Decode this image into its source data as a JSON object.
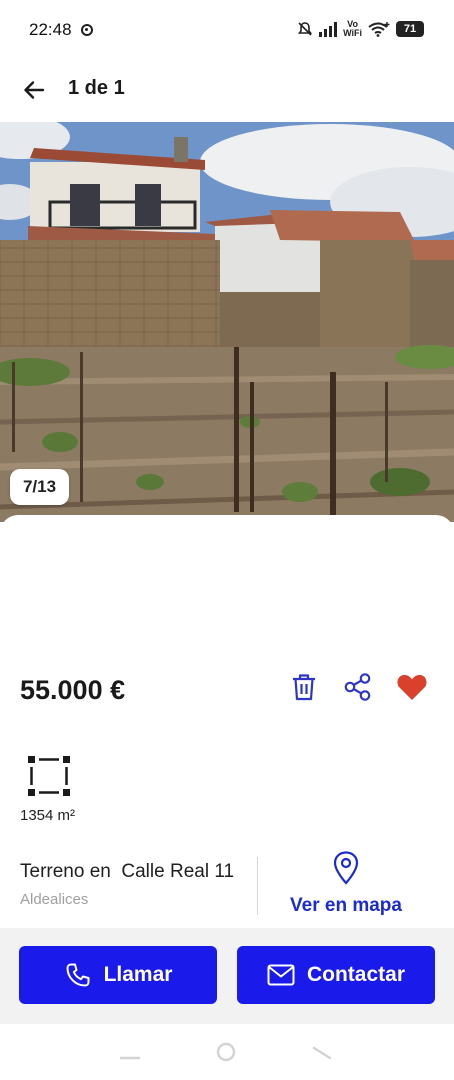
{
  "status_bar": {
    "time": "22:48",
    "vowifi_top": "Vo",
    "vowifi_bottom": "WiFi",
    "battery": "71"
  },
  "header": {
    "back_icon": "arrow-left-icon",
    "title": "1 de 1"
  },
  "gallery": {
    "counter": "7/13"
  },
  "listing": {
    "price": "55.000 €",
    "area": "1354 m²",
    "address": "Terreno en  Calle Real 11",
    "locality": "Aldealices",
    "map_link": "Ver en mapa"
  },
  "actions": {
    "delete_icon": "trash-icon",
    "share_icon": "share-icon",
    "favorite_icon": "heart-icon"
  },
  "cta": {
    "call_label": "Llamar",
    "contact_label": "Contactar"
  },
  "colors": {
    "accent": "#1a1aeb",
    "link": "#1c2bd0",
    "favorite": "#d9412c",
    "icon_blue": "#2e35c9"
  }
}
